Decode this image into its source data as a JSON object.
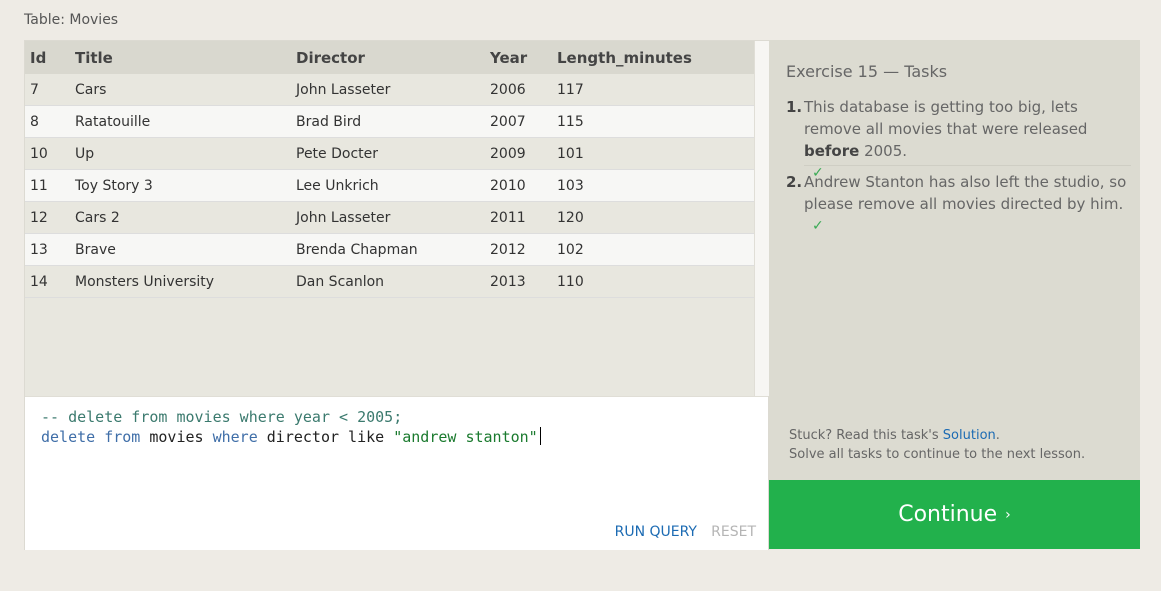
{
  "table_caption": "Table: Movies",
  "table": {
    "columns": [
      "Id",
      "Title",
      "Director",
      "Year",
      "Length_minutes"
    ],
    "rows": [
      [
        "7",
        "Cars",
        "John Lasseter",
        "2006",
        "117"
      ],
      [
        "8",
        "Ratatouille",
        "Brad Bird",
        "2007",
        "115"
      ],
      [
        "10",
        "Up",
        "Pete Docter",
        "2009",
        "101"
      ],
      [
        "11",
        "Toy Story 3",
        "Lee Unkrich",
        "2010",
        "103"
      ],
      [
        "12",
        "Cars 2",
        "John Lasseter",
        "2011",
        "120"
      ],
      [
        "13",
        "Brave",
        "Brenda Chapman",
        "2012",
        "102"
      ],
      [
        "14",
        "Monsters University",
        "Dan Scanlon",
        "2013",
        "110"
      ]
    ]
  },
  "editor": {
    "line1": "-- delete from movies where year < 2005;",
    "line2_kw1": "delete",
    "line2_kw2": "from",
    "line2_t1": "movies",
    "line2_kw3": "where",
    "line2_t2": "director like",
    "line2_str": "\"andrew stanton\"",
    "run_label": "RUN QUERY",
    "reset_label": "RESET"
  },
  "tasks": {
    "title": "Exercise 15 — Tasks",
    "items": [
      {
        "num": "1.",
        "text_before": "This database is getting too big, lets remove all movies that were released ",
        "text_bold": "before",
        "text_after": " 2005.",
        "check": "✓"
      },
      {
        "num": "2.",
        "text": "Andrew Stanton has also left the studio, so please remove all movies directed by him.",
        "check": "✓"
      }
    ],
    "help_prefix": "Stuck? Read this task's ",
    "help_link": "Solution",
    "help_suffix": ".",
    "help_line2": "Solve all tasks to continue to the next lesson."
  },
  "continue": {
    "label": "Continue",
    "chevron": "›"
  },
  "colors": {
    "continue_bg": "#22b14c",
    "link": "#1c6bb3",
    "check": "#3aaa55"
  }
}
